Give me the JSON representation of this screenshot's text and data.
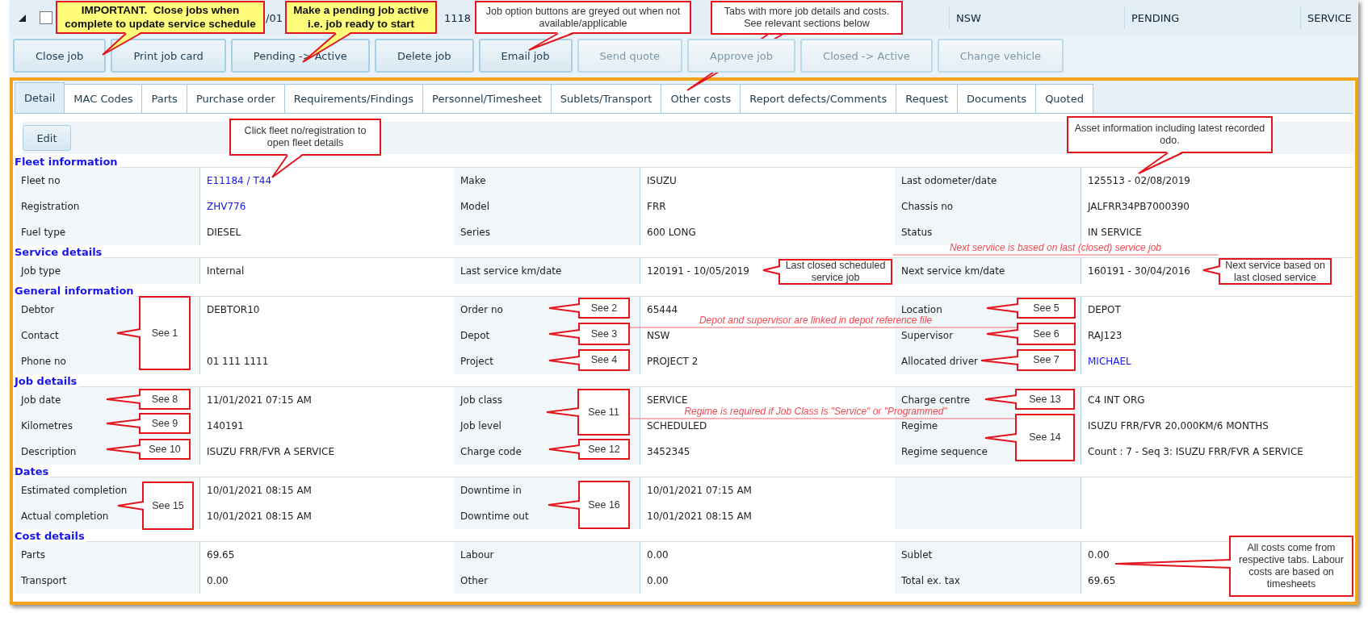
{
  "job_row": {
    "expanded": true,
    "checked": false,
    "cells": [
      "/01",
      "1118",
      "NSW",
      "PENDING",
      "SERVICE"
    ]
  },
  "toolbar": [
    {
      "label": "Close job",
      "disabled": false
    },
    {
      "label": "Print job card",
      "disabled": false
    },
    {
      "label": "Pending -> Active",
      "disabled": false
    },
    {
      "label": "Delete job",
      "disabled": false
    },
    {
      "label": "Email job",
      "disabled": false
    },
    {
      "label": "Send quote",
      "disabled": true
    },
    {
      "label": "Approve job",
      "disabled": true
    },
    {
      "label": "Closed -> Active",
      "disabled": true
    },
    {
      "label": "Change vehicle",
      "disabled": true
    }
  ],
  "tabs": [
    {
      "label": "Detail",
      "selected": true
    },
    {
      "label": "MAC Codes",
      "selected": false
    },
    {
      "label": "Parts",
      "selected": false
    },
    {
      "label": "Purchase order",
      "selected": false
    },
    {
      "label": "Requirements/Findings",
      "selected": false
    },
    {
      "label": "Personnel/Timesheet",
      "selected": false
    },
    {
      "label": "Sublets/Transport",
      "selected": false
    },
    {
      "label": "Other costs",
      "selected": false
    },
    {
      "label": "Report defects/Comments",
      "selected": false
    },
    {
      "label": "Request",
      "selected": false
    },
    {
      "label": "Documents",
      "selected": false
    },
    {
      "label": "Quoted",
      "selected": false
    }
  ],
  "edit_button": "Edit",
  "sections": [
    {
      "title": "Fleet information",
      "rows": [
        [
          {
            "label": "Fleet no",
            "value": "E11184 / T44",
            "kind": "link"
          },
          {
            "label": "Make",
            "value": "ISUZU",
            "kind": "text"
          },
          {
            "label": "Last odometer/date",
            "value": "125513 - 02/08/2019",
            "kind": "text"
          }
        ],
        [
          {
            "label": "Registration",
            "value": "ZHV776",
            "kind": "link"
          },
          {
            "label": "Model",
            "value": "FRR",
            "kind": "text"
          },
          {
            "label": "Chassis no",
            "value": "JALFRR34PB7000390",
            "kind": "text"
          }
        ],
        [
          {
            "label": "Fuel type",
            "value": "DIESEL",
            "kind": "text"
          },
          {
            "label": "Series",
            "value": "600 LONG",
            "kind": "text"
          },
          {
            "label": "Status",
            "value": "IN SERVICE",
            "kind": "text"
          }
        ]
      ]
    },
    {
      "title": "Service details",
      "rows": [
        [
          {
            "label": "Job type",
            "value": "Internal",
            "kind": "text"
          },
          {
            "label": "Last service km/date",
            "value": "120191 - 10/05/2019",
            "kind": "text"
          },
          {
            "label": "Next service km/date",
            "value": "160191 - 30/04/2016",
            "kind": "text"
          }
        ]
      ]
    },
    {
      "title": "General information",
      "rows": [
        [
          {
            "label": "Debtor",
            "value": "DEBTOR10",
            "kind": "text"
          },
          {
            "label": "Order no",
            "value": "65444",
            "kind": "text"
          },
          {
            "label": "Location",
            "value": "DEPOT",
            "kind": "text"
          }
        ],
        [
          {
            "label": "Contact"
          },
          {
            "label": "Depot",
            "value": "NSW",
            "kind": "text"
          },
          {
            "label": "Supervisor",
            "value": "RAJ123",
            "kind": "text"
          }
        ],
        [
          {
            "label": "Phone no",
            "value": "01 111 1111",
            "kind": "text"
          },
          {
            "label": "Project",
            "value": "PROJECT 2",
            "kind": "text"
          },
          {
            "label": "Allocated driver",
            "value": "MICHAEL",
            "kind": "link"
          }
        ]
      ]
    },
    {
      "title": "Job details",
      "rows": [
        [
          {
            "label": "Job date",
            "value": "11/01/2021 07:15 AM",
            "kind": "text"
          },
          {
            "label": "Job class",
            "value": "SERVICE",
            "kind": "text"
          },
          {
            "label": "Charge centre",
            "value": "C4 INT ORG",
            "kind": "text"
          }
        ],
        [
          {
            "label": "Kilometres",
            "value": "140191",
            "kind": "text"
          },
          {
            "label": "Job level",
            "value": "SCHEDULED",
            "kind": "text"
          },
          {
            "label": "Regime",
            "value": "ISUZU FRR/FVR 20,000KM/6 MONTHS",
            "kind": "text"
          }
        ],
        [
          {
            "label": "Description",
            "value": "ISUZU FRR/FVR A SERVICE",
            "kind": "text"
          },
          {
            "label": "Charge code",
            "value": "3452345",
            "kind": "text"
          },
          {
            "label": "Regime sequence",
            "value": "Count : 7 - Seq 3: ISUZU FRR/FVR A SERVICE",
            "kind": "text"
          }
        ]
      ]
    },
    {
      "title": "Dates",
      "rows": [
        [
          {
            "label": "Estimated completion",
            "value": "10/01/2021 08:15 AM",
            "kind": "text"
          },
          {
            "label": "Downtime in",
            "value": "10/01/2021 07:15 AM",
            "kind": "text"
          },
          {}
        ],
        [
          {
            "label": "Actual completion",
            "value": "10/01/2021 08:15 AM",
            "kind": "text"
          },
          {
            "label": "Downtime out",
            "value": "10/01/2021 08:15 AM",
            "kind": "text"
          },
          {}
        ]
      ]
    },
    {
      "title": "Cost details",
      "rows": [
        [
          {
            "label": "Parts",
            "value": "69.65",
            "kind": "text"
          },
          {
            "label": "Labour",
            "value": "0.00",
            "kind": "text"
          },
          {
            "label": "Sublet",
            "value": "0.00",
            "kind": "text"
          }
        ],
        [
          {
            "label": "Transport",
            "value": "0.00",
            "kind": "text"
          },
          {
            "label": "Other",
            "value": "0.00",
            "kind": "text"
          },
          {
            "label": "Total ex. tax",
            "value": "69.65",
            "kind": "text"
          }
        ]
      ]
    }
  ],
  "callouts": [
    {
      "kind": "important",
      "text": "IMPORTANT.  Close jobs when complete to update service schedule"
    },
    {
      "kind": "important",
      "text": "Make a pending job active i.e. job ready to start"
    },
    {
      "kind": "note",
      "text": "Job option buttons are greyed out when not available/applicable"
    },
    {
      "kind": "note",
      "text": "Tabs with more job details and costs. See relevant sections below"
    },
    {
      "kind": "note",
      "text": "Click fleet no/registration to open fleet details"
    },
    {
      "kind": "note",
      "text": "Asset information including latest recorded odo."
    },
    {
      "kind": "note",
      "text": "Last closed scheduled service job"
    },
    {
      "kind": "note",
      "text": "Next service based on last closed service"
    },
    {
      "kind": "note",
      "text": "See 1"
    },
    {
      "kind": "note",
      "text": "See 2"
    },
    {
      "kind": "note",
      "text": "See 3"
    },
    {
      "kind": "note",
      "text": "See 4"
    },
    {
      "kind": "note",
      "text": "See 5"
    },
    {
      "kind": "note",
      "text": "See 6"
    },
    {
      "kind": "note",
      "text": "See 7"
    },
    {
      "kind": "note",
      "text": "See 8"
    },
    {
      "kind": "note",
      "text": "See 9"
    },
    {
      "kind": "note",
      "text": "See 10"
    },
    {
      "kind": "note",
      "text": "See 11"
    },
    {
      "kind": "note",
      "text": "See 12"
    },
    {
      "kind": "note",
      "text": "See 13"
    },
    {
      "kind": "note",
      "text": "See 14"
    },
    {
      "kind": "note",
      "text": "See 15"
    },
    {
      "kind": "note",
      "text": "See 16"
    },
    {
      "kind": "note",
      "text": "All costs come from respective tabs. Labour costs are based on timesheets"
    }
  ],
  "annotations": [
    {
      "text": "Next serviice is based on last (closed) service job"
    },
    {
      "text": "Depot and supervisor are linked in depot reference file"
    },
    {
      "text": "Regime is required if Job Class is \"Service\" or \"Programmed\""
    }
  ]
}
